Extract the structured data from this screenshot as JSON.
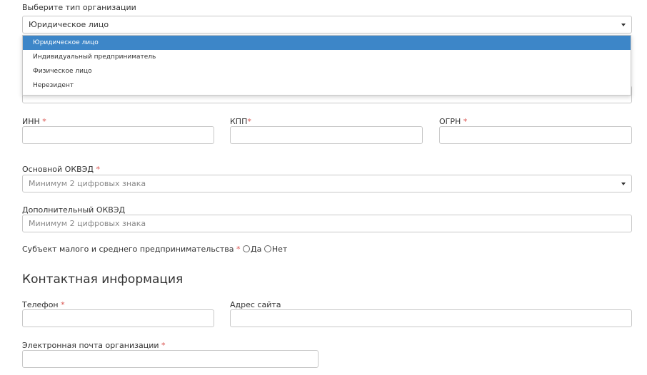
{
  "org_type": {
    "label": "Выберите тип организации",
    "selected": "Юридическое лицо",
    "options": [
      "Юридическое лицо",
      "Индивидуальный предприниматель",
      "Физическое лицо",
      "Нерезидент"
    ]
  },
  "requisites": {
    "inn_label": "ИНН",
    "kpp_label": "КПП",
    "ogrn_label": "ОГРН",
    "required_mark": "*"
  },
  "okved_main": {
    "label": "Основной ОКВЭД",
    "placeholder": "Минимум 2 цифровых знака"
  },
  "okved_extra": {
    "label": "Дополнительный ОКВЭД",
    "placeholder": "Минимум 2 цифровых знака"
  },
  "sme": {
    "label": "Субъект малого и среднего предпринимательства",
    "yes": "Да",
    "no": "Нет"
  },
  "contacts": {
    "title": "Контактная информация",
    "phone_label": "Телефон",
    "site_label": "Адрес сайта",
    "email_label": "Электронная почта организации"
  },
  "colors": {
    "accent": "#3d86c8",
    "required": "#d9534f",
    "border": "#c8c8c8"
  }
}
